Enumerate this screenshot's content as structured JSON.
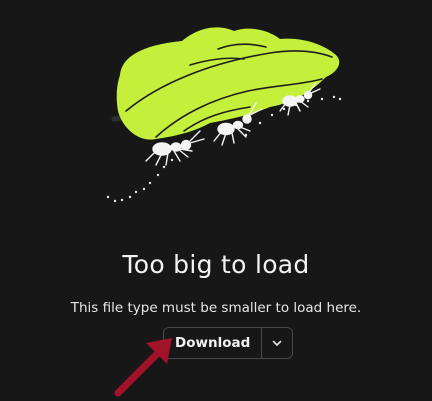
{
  "empty_state": {
    "title": "Too big to load",
    "message": "This file type must be smaller to load here.",
    "illustration_icon": "ants-carrying-leaf-illustration"
  },
  "actions": {
    "download_label": "Download",
    "more_options_icon": "chevron-down-icon"
  },
  "annotation": {
    "arrow_icon": "pointer-arrow",
    "arrow_color": "#a3122b"
  },
  "colors": {
    "background": "#171717",
    "leaf": "#c4ef3a",
    "text": "#f2f2f2",
    "border": "#4a4a4a"
  }
}
